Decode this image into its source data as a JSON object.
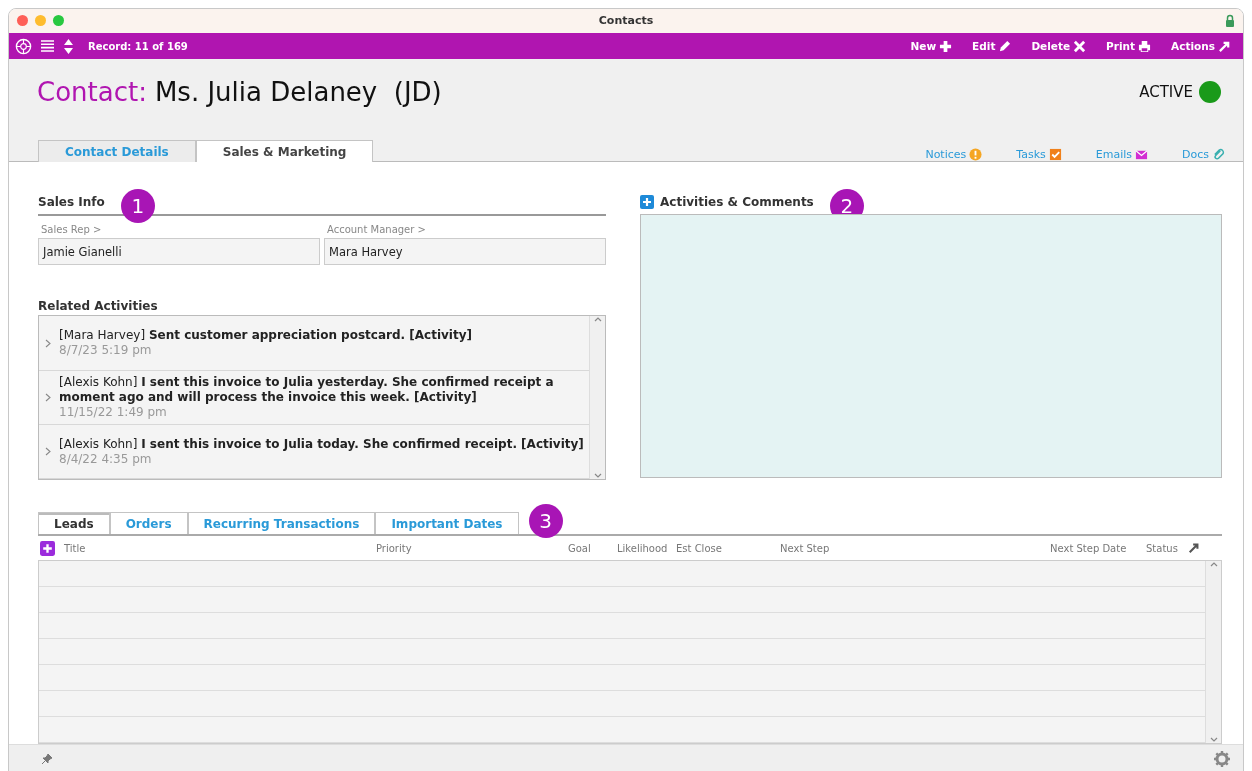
{
  "window": {
    "title": "Contacts",
    "locked": true
  },
  "toolbar": {
    "record": "Record: 11 of 169",
    "actions": [
      {
        "label": "New",
        "kind": "new"
      },
      {
        "label": "Edit",
        "kind": "edit"
      },
      {
        "label": "Delete",
        "kind": "delete"
      },
      {
        "label": "Print",
        "kind": "print"
      },
      {
        "label": "Actions",
        "kind": "actions"
      }
    ]
  },
  "header": {
    "prefix": "Contact:",
    "name": "Ms. Julia Delaney  (JD)",
    "status": "ACTIVE",
    "active": true
  },
  "tabs": [
    {
      "label": "Contact Details",
      "selected": false
    },
    {
      "label": "Sales & Marketing",
      "selected": true
    }
  ],
  "links": [
    {
      "label": "Notices",
      "kind": "notices"
    },
    {
      "label": "Tasks",
      "kind": "tasks"
    },
    {
      "label": "Emails",
      "kind": "emails"
    },
    {
      "label": "Docs",
      "kind": "docs"
    }
  ],
  "sales_info": {
    "title": "Sales Info",
    "badge": "1",
    "fields": [
      {
        "label": "Sales Rep >",
        "value": "Jamie Gianelli"
      },
      {
        "label": "Account Manager >",
        "value": "Mara Harvey"
      }
    ]
  },
  "related_activities": {
    "title": "Related Activities",
    "items": [
      {
        "text": "[Mara Harvey] **Sent customer appreciation postcard. [Activity]**",
        "date": "8/7/23  5:19 pm"
      },
      {
        "text": "[Alexis Kohn] **I sent this invoice to Julia yesterday. She confirmed receipt a moment ago and will process the invoice this week. [Activity]**",
        "date": "11/15/22  1:49 pm"
      },
      {
        "text": "[Alexis Kohn] **I sent this invoice to Julia today. She confirmed receipt. [Activity]**",
        "date": "8/4/22  4:35 pm"
      }
    ]
  },
  "activities_comments": {
    "title": "Activities & Comments",
    "badge": "2"
  },
  "bottom_tabs": [
    {
      "label": "Leads",
      "selected": true
    },
    {
      "label": "Orders",
      "selected": false
    },
    {
      "label": "Recurring Transactions",
      "selected": false
    },
    {
      "label": "Important Dates",
      "selected": false
    }
  ],
  "bottom_badge": "3",
  "table": {
    "columns": [
      "Title",
      "Priority",
      "Goal",
      "Likelihood",
      "Est Close",
      "Next Step",
      "Next Step Date",
      "Status"
    ]
  }
}
